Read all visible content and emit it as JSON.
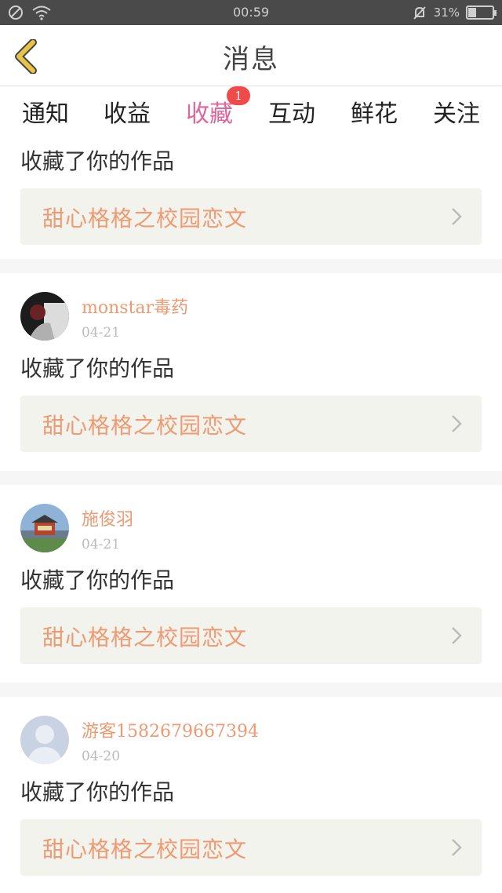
{
  "status_bar": {
    "time": "00:59",
    "battery_percent": "31%",
    "battery_level": 0.31
  },
  "header": {
    "title": "消息"
  },
  "tabs": [
    {
      "label": "通知"
    },
    {
      "label": "收益"
    },
    {
      "label": "收藏",
      "active": true,
      "badge": "1"
    },
    {
      "label": "互动"
    },
    {
      "label": "鲜花"
    },
    {
      "label": "关注"
    }
  ],
  "messages": [
    {
      "action": "收藏了你的作品",
      "work_title": "甜心格格之校园恋文"
    },
    {
      "user": "monstar毒药",
      "date": "04-21",
      "action": "收藏了你的作品",
      "work_title": "甜心格格之校园恋文",
      "avatar": "dark-photo-avatar"
    },
    {
      "user": "施俊羽",
      "date": "04-21",
      "action": "收藏了你的作品",
      "work_title": "甜心格格之校园恋文",
      "avatar": "building-photo-avatar"
    },
    {
      "user": "游客15826796673​94",
      "date": "04-20",
      "action": "收藏了你的作品",
      "work_title": "甜心格格之校园恋文",
      "avatar": "default-avatar"
    }
  ],
  "colors": {
    "accent": "#e0659a",
    "work_text": "#ee9a72",
    "back_arrow": "#e8c34a"
  }
}
